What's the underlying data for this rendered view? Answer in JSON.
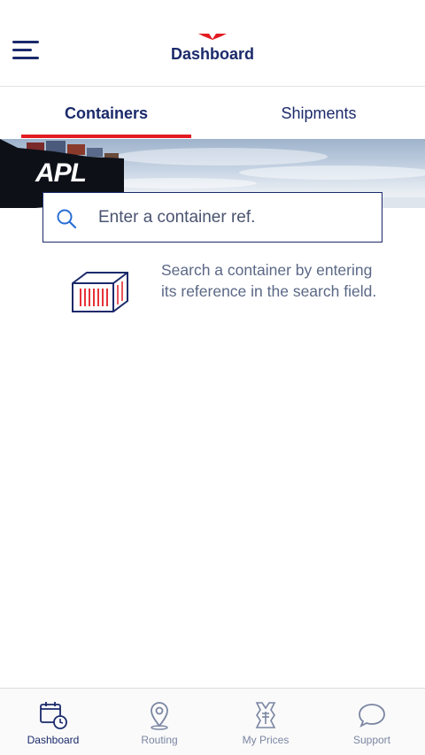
{
  "header": {
    "title": "Dashboard",
    "menu_icon": "hamburger-menu-icon",
    "logo_icon": "lion-logo-icon"
  },
  "tabs": [
    {
      "label": "Containers",
      "active": true
    },
    {
      "label": "Shipments",
      "active": false
    }
  ],
  "banner": {
    "brand_text": "APL"
  },
  "search": {
    "placeholder": "Enter a container ref.",
    "value": "",
    "icon": "search-icon"
  },
  "hint": {
    "text": "Search a container by entering its reference in the search field.",
    "icon": "shipping-container-icon"
  },
  "bottom_nav": [
    {
      "label": "Dashboard",
      "icon": "calendar-clock-icon",
      "active": true
    },
    {
      "label": "Routing",
      "icon": "map-pin-icon",
      "active": false
    },
    {
      "label": "My Prices",
      "icon": "price-tag-icon",
      "active": false
    },
    {
      "label": "Support",
      "icon": "chat-bubble-icon",
      "active": false
    }
  ],
  "colors": {
    "brand_navy": "#1b2a6b",
    "accent_red": "#e31b23",
    "muted_text": "#5b6886",
    "nav_inactive": "#7b86a3"
  }
}
